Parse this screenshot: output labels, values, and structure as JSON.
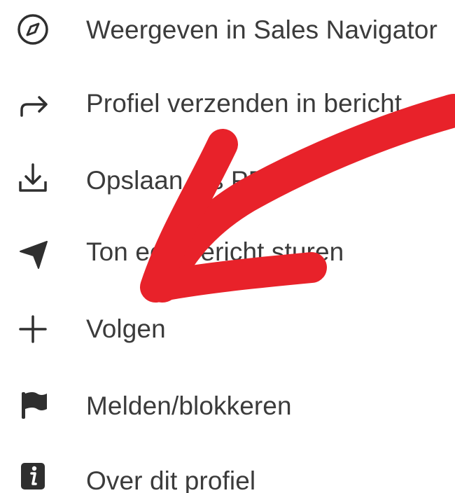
{
  "menu": {
    "items": [
      {
        "label": "Weergeven in Sales Navigator",
        "icon": "compass-icon"
      },
      {
        "label": "Profiel verzenden in bericht",
        "icon": "share-arrow-icon"
      },
      {
        "label": "Opslaan als PDF",
        "icon": "download-icon"
      },
      {
        "label": "Ton een bericht sturen",
        "icon": "send-icon"
      },
      {
        "label": "Volgen",
        "icon": "plus-icon"
      },
      {
        "label": "Melden/blokkeren",
        "icon": "flag-icon"
      },
      {
        "label": "Over dit profiel",
        "icon": "info-icon"
      }
    ]
  },
  "colors": {
    "text": "#3b3b3b",
    "icon": "#2f2f2f",
    "annotation_arrow": "#e8222a"
  }
}
